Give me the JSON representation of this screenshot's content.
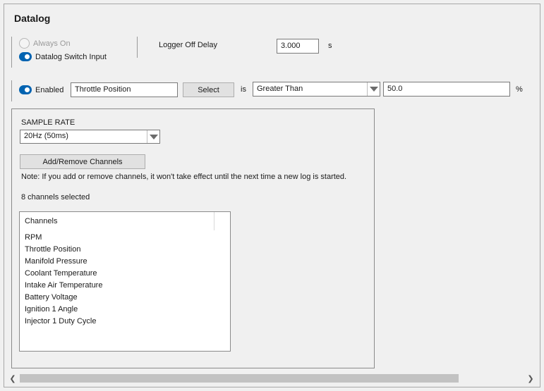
{
  "panel": {
    "title": "Datalog"
  },
  "mode": {
    "always_on_label": "Always On",
    "switch_input_label": "Datalog Switch Input"
  },
  "logger": {
    "off_delay_label": "Logger Off Delay",
    "off_delay_value": "3.000",
    "off_delay_unit": "s"
  },
  "trigger": {
    "enabled_label": "Enabled",
    "channel_value": "Throttle Position",
    "select_label": "Select",
    "is_label": "is",
    "operator_value": "Greater Than",
    "threshold_value": "50.0",
    "threshold_unit": "%"
  },
  "sampling": {
    "label": "SAMPLE RATE",
    "rate_value": "20Hz (50ms)",
    "add_remove_label": "Add/Remove Channels",
    "note": "Note: If you add or remove channels, it won't take effect until the next time a new log is started.",
    "selected_count": "8 channels selected"
  },
  "channels": {
    "header": "Channels",
    "items": [
      "RPM",
      "Throttle Position",
      "Manifold Pressure",
      "Coolant Temperature",
      "Intake Air Temperature",
      "Battery Voltage",
      "Ignition 1 Angle",
      "Injector 1 Duty Cycle"
    ]
  },
  "colors": {
    "accent": "#0063b1"
  }
}
